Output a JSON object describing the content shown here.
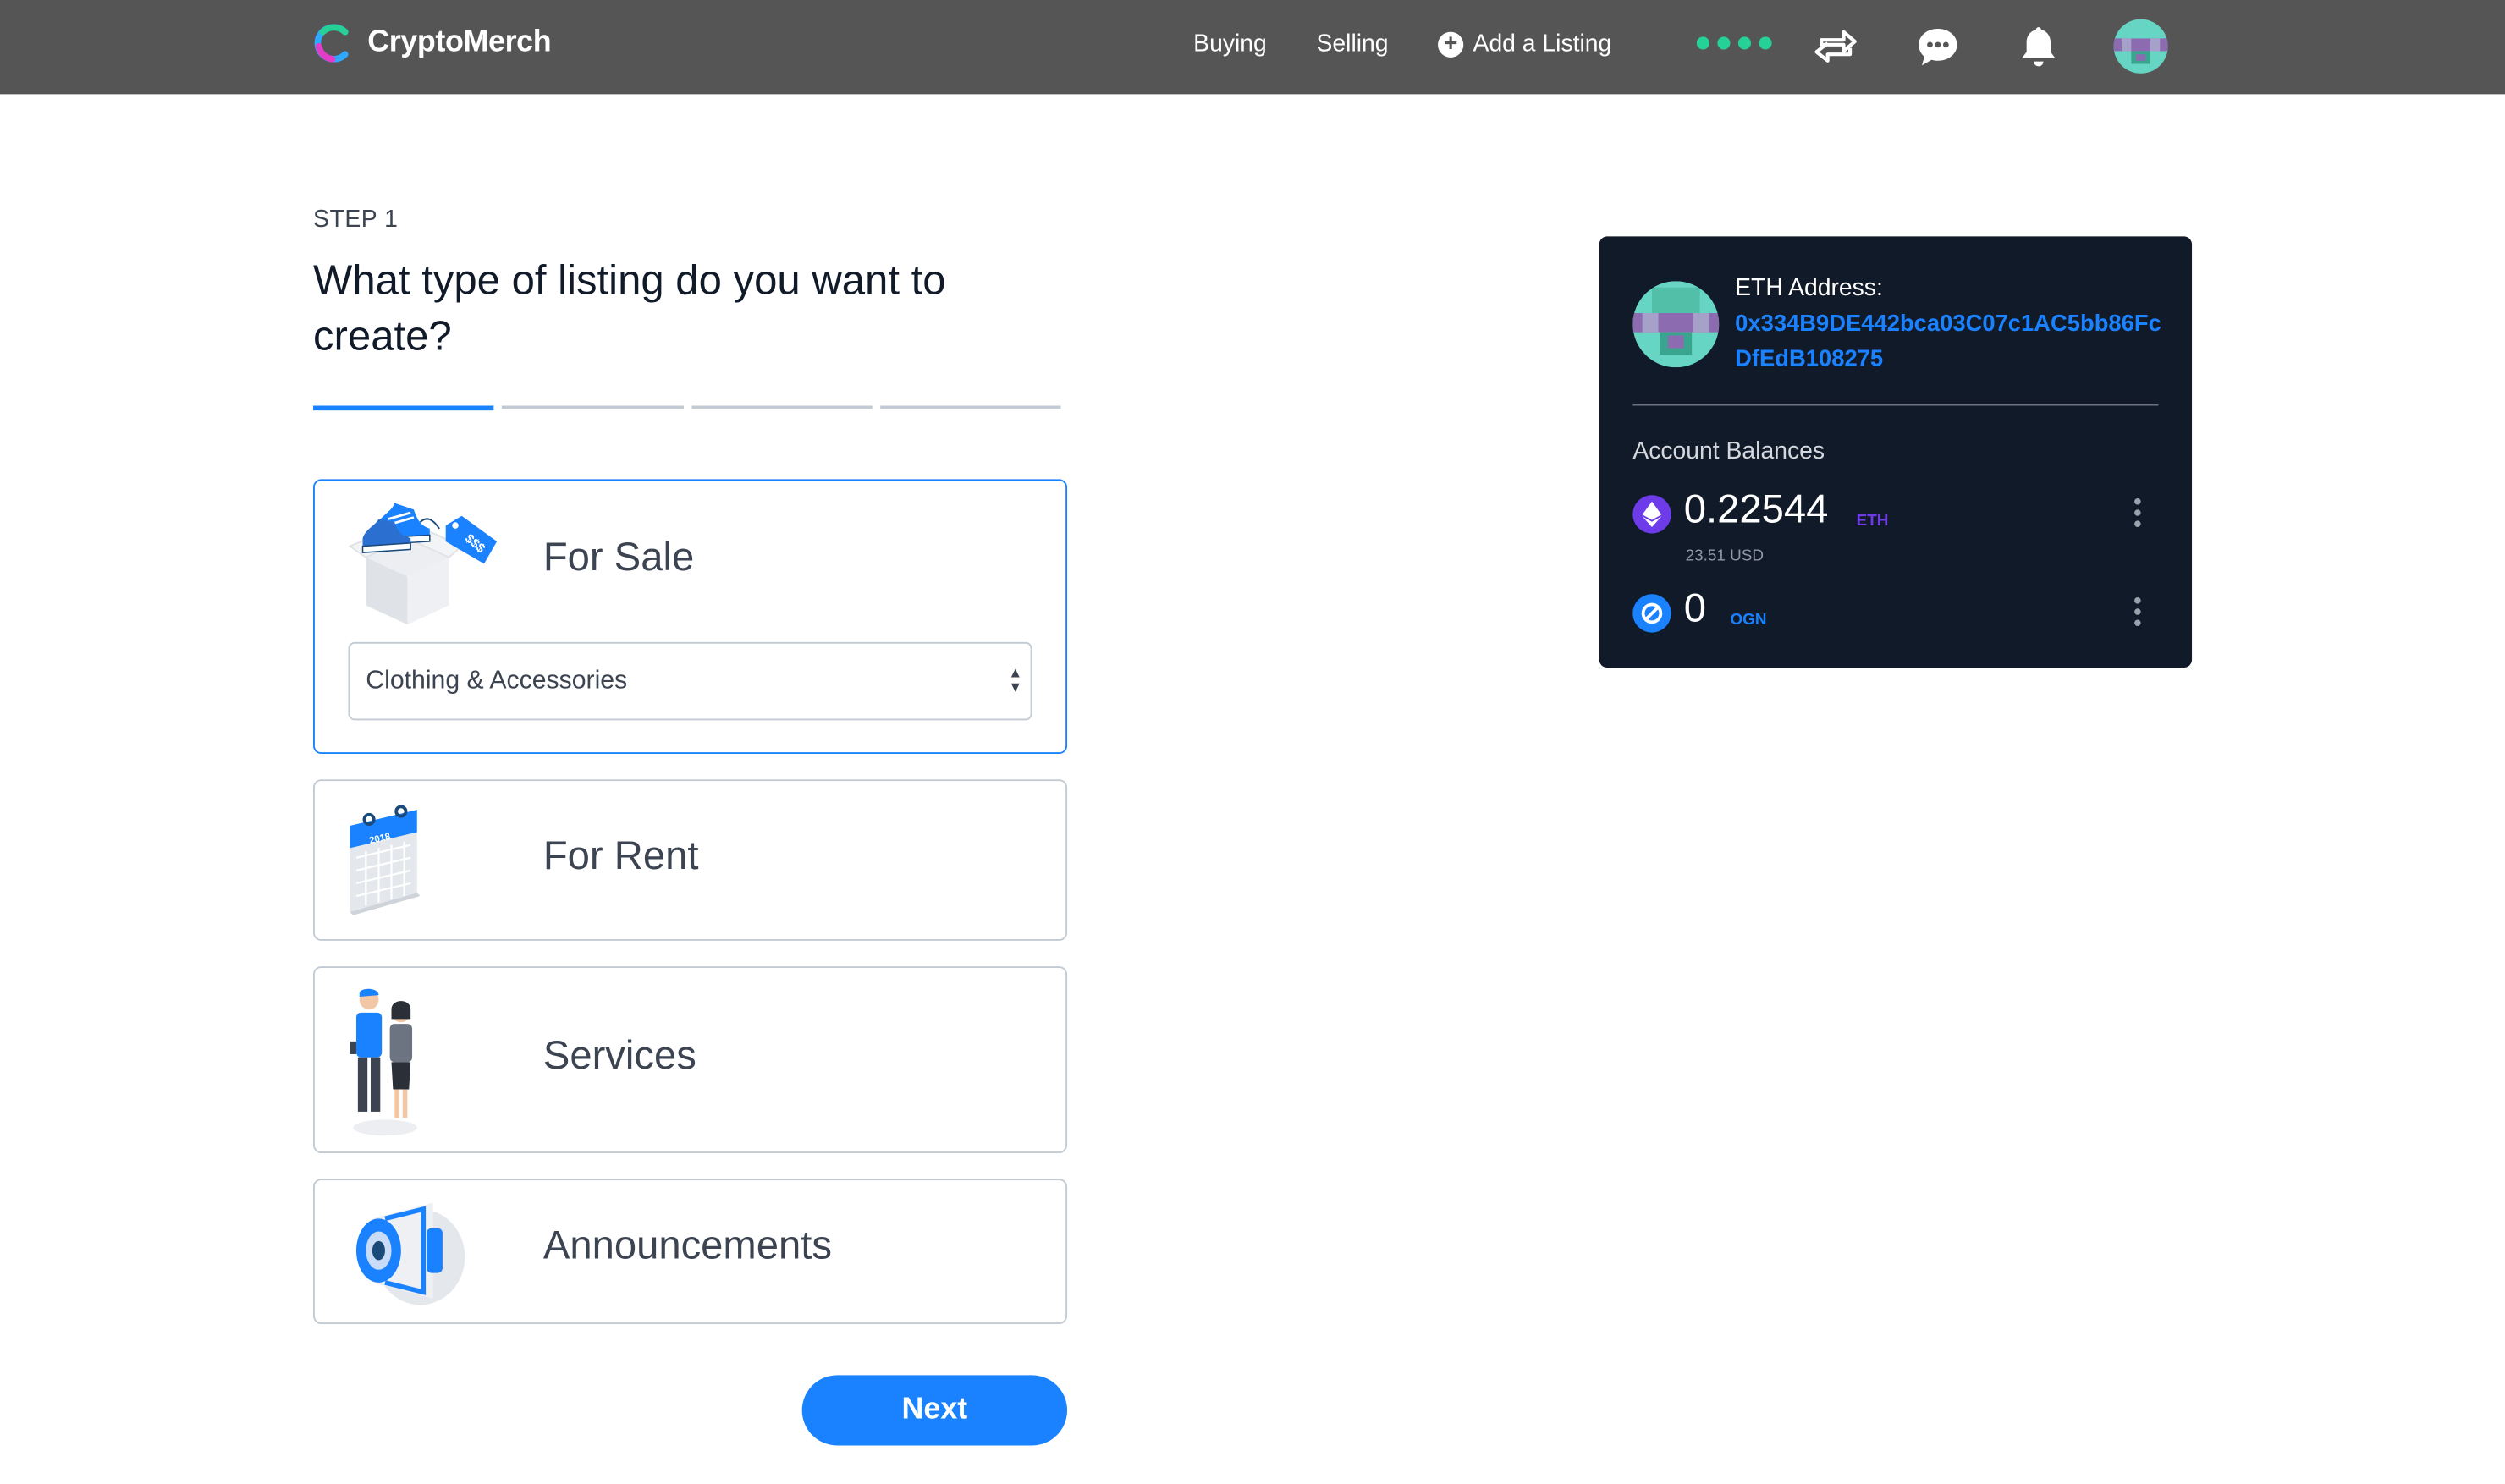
{
  "navbar": {
    "brand_name": "CryptoMerch",
    "links": {
      "buying": "Buying",
      "selling": "Selling",
      "add_listing": "Add a Listing"
    }
  },
  "form": {
    "step_label": "STEP 1",
    "question": "What type of listing do you want to create?",
    "progress": {
      "total_steps": 4,
      "current_step": 1
    },
    "options": {
      "for_sale": "For Sale",
      "for_rent": "For Rent",
      "services": "Services",
      "announcements": "Announcements"
    },
    "selected_option": "For Sale",
    "category_select": {
      "value": "Clothing & Accessories"
    },
    "next_button": "Next"
  },
  "wallet": {
    "eth_address_label": "ETH Address:",
    "eth_address": "0x334B9DE442bca03C07c1AC5bb86FcDfEdB108275",
    "balances_label": "Account Balances",
    "balances": {
      "eth": {
        "amount": "0.22544",
        "symbol": "ETH",
        "usd": "23.51 USD"
      },
      "ogn": {
        "amount": "0",
        "symbol": "OGN"
      }
    }
  },
  "colors": {
    "navbar_bg": "#555555",
    "accent_blue": "#1a82ff",
    "status_green": "#26d198",
    "wallet_bg": "#111a29",
    "eth_purple": "#6e3bea"
  },
  "icons": {
    "brand": "cryptomerch-logo-icon",
    "transfer": "transfer-arrows-icon",
    "messages": "chat-bubble-icon",
    "notifications": "bell-icon",
    "add": "plus-circle-icon"
  }
}
